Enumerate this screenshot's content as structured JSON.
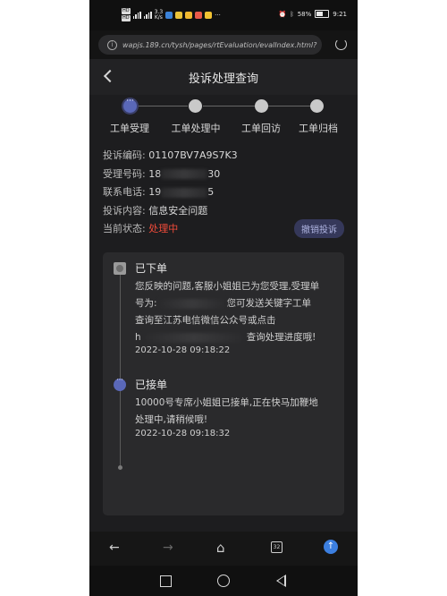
{
  "status_bar": {
    "sim1": "HD",
    "sim2": "HD",
    "speed_value": "3.3",
    "speed_unit": "K/s",
    "battery": "58",
    "time": "9:21"
  },
  "browser": {
    "url": "wapjs.189.cn/tysh/pages/rtEvaluation/evalIndex.html?"
  },
  "header": {
    "title": "投诉处理查询"
  },
  "steps": [
    {
      "label": "工单受理",
      "active": true
    },
    {
      "label": "工单处理中",
      "active": false
    },
    {
      "label": "工单回访",
      "active": false
    },
    {
      "label": "工单归档",
      "active": false
    }
  ],
  "info": {
    "code_label": "投诉编码:",
    "code_value": "01107BV7A9S7K3",
    "accept_label": "受理号码:",
    "accept_value": "18",
    "accept_suffix": "30",
    "phone_label": "联系电话:",
    "phone_value": "19",
    "phone_suffix": "5",
    "content_label": "投诉内容:",
    "content_value": "信息安全问题",
    "status_label": "当前状态:",
    "status_value": "处理中",
    "cancel_label": "撤销投诉"
  },
  "timeline": [
    {
      "title": "已下单",
      "line1": "您反映的问题,客服小姐姐已为您受理,受理单",
      "line2a": "号为:",
      "line2b": "您可发送关键字工单",
      "line3": "查询至江苏电信微信公众号或点击",
      "line4a": "h",
      "line4b": "查询处理进度哦!",
      "time": "2022-10-28 09:18:22"
    },
    {
      "title": "已接单",
      "line1": "10000号专席小姐姐已接单,正在快马加鞭地",
      "line2": "处理中,请稍候哦!",
      "time": "2022-10-28 09:18:32"
    }
  ],
  "browser_nav": {
    "tab_count": "32"
  }
}
